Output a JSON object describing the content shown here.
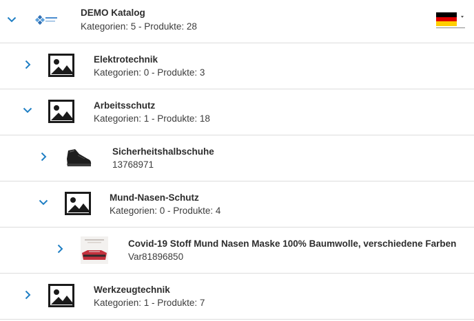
{
  "catalog": {
    "title": "DEMO Katalog",
    "subtitle": "Kategorien: 5 - Produkte: 28",
    "logo_icon": "company-logo",
    "expanded": true
  },
  "language": {
    "flag_icon": "german-flag-icon",
    "colors": [
      "#000000",
      "#dd0000",
      "#ffce00"
    ]
  },
  "accent_color": "#1f7fc4",
  "rows": [
    {
      "title": "Elektrotechnik",
      "subtitle": "Kategorien: 0 - Produkte: 3",
      "expanded": false,
      "icon": "image-placeholder-icon"
    },
    {
      "title": "Arbeitsschutz",
      "subtitle": "Kategorien: 1 - Produkte: 18",
      "expanded": true,
      "icon": "image-placeholder-icon"
    },
    {
      "title": "Sicherheitshalbschuhe",
      "subtitle": "13768971",
      "expanded": false,
      "icon": "safety-shoe-photo"
    },
    {
      "title": "Mund-Nasen-Schutz",
      "subtitle": "Kategorien: 0 - Produkte: 4",
      "expanded": true,
      "icon": "image-placeholder-icon"
    },
    {
      "title": "Covid-19 Stoff Mund Nasen Maske 100% Baumwolle, verschiedene Farben",
      "subtitle": "Var81896850",
      "expanded": false,
      "icon": "face-mask-photo"
    },
    {
      "title": "Werkzeugtechnik",
      "subtitle": "Kategorien: 1 - Produkte: 7",
      "expanded": false,
      "icon": "image-placeholder-icon"
    }
  ]
}
